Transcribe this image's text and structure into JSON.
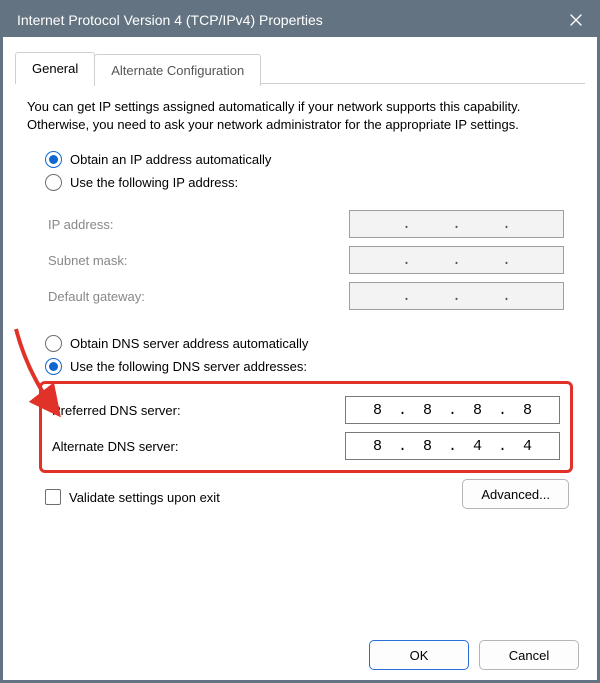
{
  "titlebar": {
    "title": "Internet Protocol Version 4 (TCP/IPv4) Properties"
  },
  "tabs": {
    "general": "General",
    "alt": "Alternate Configuration"
  },
  "intro": "You can get IP settings assigned automatically if your network supports this capability. Otherwise, you need to ask your network administrator for the appropriate IP settings.",
  "ip": {
    "auto_label": "Obtain an IP address automatically",
    "manual_label": "Use the following IP address:",
    "fields": {
      "ip_address": "IP address:",
      "subnet": "Subnet mask:",
      "gateway": "Default gateway:"
    },
    "values": {
      "ip_address": [
        "",
        "",
        "",
        ""
      ],
      "subnet": [
        "",
        "",
        "",
        ""
      ],
      "gateway": [
        "",
        "",
        "",
        ""
      ]
    },
    "selected": "auto"
  },
  "dns": {
    "auto_label": "Obtain DNS server address automatically",
    "manual_label": "Use the following DNS server addresses:",
    "fields": {
      "preferred": "Preferred DNS server:",
      "alternate": "Alternate DNS server:"
    },
    "values": {
      "preferred": [
        "8",
        "8",
        "8",
        "8"
      ],
      "alternate": [
        "8",
        "8",
        "4",
        "4"
      ]
    },
    "selected": "manual"
  },
  "validate_label": "Validate settings upon exit",
  "advanced_label": "Advanced...",
  "buttons": {
    "ok": "OK",
    "cancel": "Cancel"
  },
  "sep": "."
}
